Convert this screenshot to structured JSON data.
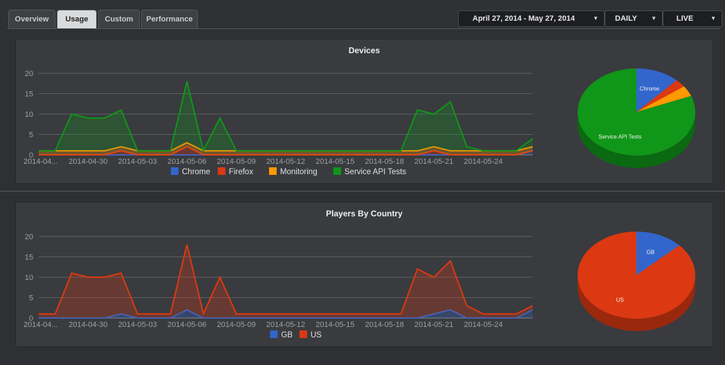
{
  "tabs": [
    {
      "label": "Overview",
      "active": false
    },
    {
      "label": "Usage",
      "active": true
    },
    {
      "label": "Custom",
      "active": false
    },
    {
      "label": "Performance",
      "active": false
    }
  ],
  "controls": {
    "date_range": "April 27, 2014 - May 27, 2014",
    "interval": "DAILY",
    "mode": "LIVE"
  },
  "chart_data": [
    {
      "type": "area",
      "title": "Devices",
      "ylim": [
        0,
        20
      ],
      "yticks": [
        0,
        5,
        10,
        15,
        20
      ],
      "grid": true,
      "legend_position": "bottom",
      "x": [
        "2014-04-27",
        "2014-04-28",
        "2014-04-29",
        "2014-04-30",
        "2014-05-01",
        "2014-05-02",
        "2014-05-03",
        "2014-05-04",
        "2014-05-05",
        "2014-05-06",
        "2014-05-07",
        "2014-05-08",
        "2014-05-09",
        "2014-05-10",
        "2014-05-11",
        "2014-05-12",
        "2014-05-13",
        "2014-05-14",
        "2014-05-15",
        "2014-05-16",
        "2014-05-17",
        "2014-05-18",
        "2014-05-19",
        "2014-05-20",
        "2014-05-21",
        "2014-05-22",
        "2014-05-23",
        "2014-05-24",
        "2014-05-25",
        "2014-05-26",
        "2014-05-27"
      ],
      "xtick_labels": [
        "2014-04...",
        "2014-04-30",
        "2014-05-03",
        "2014-05-06",
        "2014-05-09",
        "2014-05-12",
        "2014-05-15",
        "2014-05-18",
        "2014-05-21",
        "2014-05-24"
      ],
      "series": [
        {
          "name": "Chrome",
          "color": "#3366cc",
          "values": [
            0,
            0,
            0,
            0,
            0,
            0,
            0,
            0,
            0,
            0,
            0,
            0,
            0,
            0,
            0,
            0,
            0,
            0,
            0,
            0,
            0,
            0,
            0,
            0,
            0,
            0,
            0,
            0,
            0,
            0,
            1
          ]
        },
        {
          "name": "Firefox",
          "color": "#dc3912",
          "values": [
            0,
            0,
            0,
            0,
            0,
            1,
            0,
            0,
            0,
            2,
            0,
            0,
            0,
            0,
            0,
            0,
            0,
            0,
            0,
            0,
            0,
            0,
            0,
            0,
            1,
            0,
            0,
            0,
            0,
            0,
            0
          ]
        },
        {
          "name": "Monitoring",
          "color": "#ff9900",
          "values": [
            1,
            1,
            1,
            1,
            1,
            1,
            1,
            1,
            1,
            1,
            1,
            1,
            1,
            1,
            1,
            1,
            1,
            1,
            1,
            1,
            1,
            1,
            1,
            1,
            1,
            1,
            1,
            1,
            1,
            1,
            1
          ]
        },
        {
          "name": "Service API Tests",
          "color": "#109618",
          "values": [
            0,
            0,
            9,
            8,
            8,
            9,
            0,
            0,
            0,
            15,
            0,
            8,
            0,
            0,
            0,
            0,
            0,
            0,
            0,
            0,
            0,
            0,
            0,
            10,
            8,
            12,
            1,
            0,
            0,
            0,
            2
          ]
        }
      ],
      "pie": {
        "slices": [
          {
            "label": "Chrome",
            "value": 12,
            "color": "#3366cc"
          },
          {
            "label": "Firefox",
            "value": 3,
            "color": "#dc3912"
          },
          {
            "label": "Monitoring",
            "value": 4,
            "color": "#ff9900"
          },
          {
            "label": "Service API Tests",
            "value": 81,
            "color": "#109618"
          }
        ],
        "shown_labels": [
          "Chrome",
          "Service API Tests"
        ]
      }
    },
    {
      "type": "area",
      "title": "Players By Country",
      "ylim": [
        0,
        20
      ],
      "yticks": [
        0,
        5,
        10,
        15,
        20
      ],
      "grid": true,
      "legend_position": "bottom",
      "x": [
        "2014-04-27",
        "2014-04-28",
        "2014-04-29",
        "2014-04-30",
        "2014-05-01",
        "2014-05-02",
        "2014-05-03",
        "2014-05-04",
        "2014-05-05",
        "2014-05-06",
        "2014-05-07",
        "2014-05-08",
        "2014-05-09",
        "2014-05-10",
        "2014-05-11",
        "2014-05-12",
        "2014-05-13",
        "2014-05-14",
        "2014-05-15",
        "2014-05-16",
        "2014-05-17",
        "2014-05-18",
        "2014-05-19",
        "2014-05-20",
        "2014-05-21",
        "2014-05-22",
        "2014-05-23",
        "2014-05-24",
        "2014-05-25",
        "2014-05-26",
        "2014-05-27"
      ],
      "xtick_labels": [
        "2014-04...",
        "2014-04-30",
        "2014-05-03",
        "2014-05-06",
        "2014-05-09",
        "2014-05-12",
        "2014-05-15",
        "2014-05-18",
        "2014-05-21",
        "2014-05-24"
      ],
      "series": [
        {
          "name": "GB",
          "color": "#3366cc",
          "values": [
            0,
            0,
            0,
            0,
            0,
            1,
            0,
            0,
            0,
            2,
            0,
            0,
            0,
            0,
            0,
            0,
            0,
            0,
            0,
            0,
            0,
            0,
            0,
            0,
            1,
            2,
            0,
            0,
            0,
            0,
            2
          ]
        },
        {
          "name": "US",
          "color": "#dc3912",
          "values": [
            1,
            1,
            11,
            10,
            10,
            10,
            1,
            1,
            1,
            16,
            1,
            10,
            1,
            1,
            1,
            1,
            1,
            1,
            1,
            1,
            1,
            1,
            1,
            12,
            9,
            12,
            3,
            1,
            1,
            1,
            1
          ]
        }
      ],
      "pie": {
        "slices": [
          {
            "label": "GB",
            "value": 13,
            "color": "#3366cc"
          },
          {
            "label": "US",
            "value": 87,
            "color": "#dc3912"
          }
        ],
        "shown_labels": [
          "GB",
          "US"
        ]
      }
    }
  ]
}
